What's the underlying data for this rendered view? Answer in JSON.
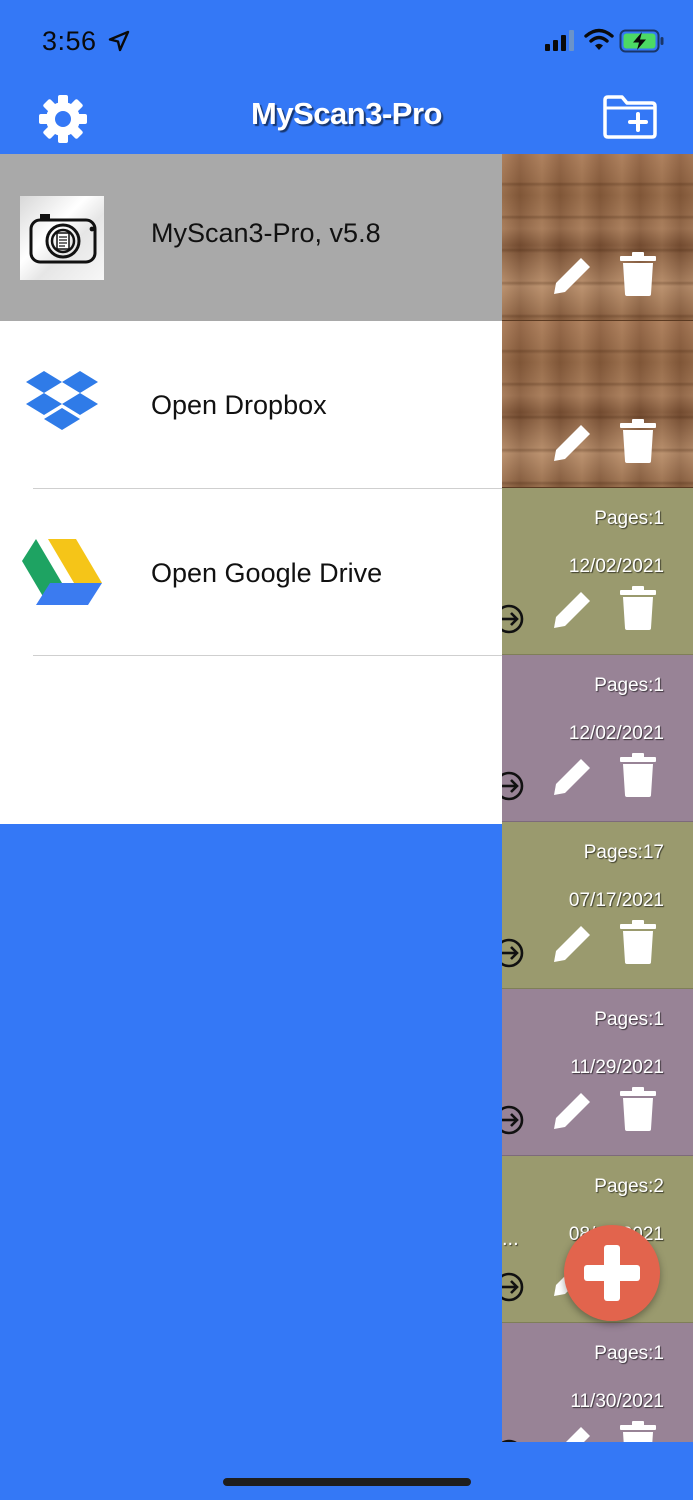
{
  "status_bar": {
    "time": "3:56",
    "icons": [
      "location-arrow-icon",
      "cellular-signal-icon",
      "wifi-icon",
      "battery-charging-icon"
    ]
  },
  "nav": {
    "title": "MyScan3-Pro",
    "left_icon": "gear-icon",
    "right_icon": "new-folder-icon"
  },
  "drawer": {
    "header": {
      "app_name_version": "MyScan3-Pro, v5.8",
      "logo_icon": "camera-logo-icon"
    },
    "items": [
      {
        "label": "Open Dropbox",
        "icon": "dropbox-icon"
      },
      {
        "label": "Open Google Drive",
        "icon": "google-drive-icon"
      }
    ]
  },
  "files": [
    {
      "style": "wood",
      "pages": "",
      "date": ""
    },
    {
      "style": "wood",
      "pages": "",
      "date": ""
    },
    {
      "style": "olive",
      "pages": "Pages:1",
      "date": "12/02/2021"
    },
    {
      "style": "mauve",
      "pages": "Pages:1",
      "date": "12/02/2021"
    },
    {
      "style": "olive",
      "pages": "Pages:17",
      "date": "07/17/2021"
    },
    {
      "style": "mauve",
      "pages": "Pages:1",
      "date": "11/29/2021"
    },
    {
      "style": "olive",
      "pages": "Pages:2",
      "date": "08/__/2021",
      "ellipsis": "..."
    },
    {
      "style": "mauve",
      "pages": "Pages:1",
      "date": "11/30/2021"
    }
  ],
  "fab": {
    "icon": "plus-icon"
  },
  "colors": {
    "nav_blue": "#3478f6",
    "drawer_header_gray": "#a9a9a9",
    "fab_red": "#e2644d",
    "card_olive": "#9a9a6e",
    "card_mauve": "#988396"
  }
}
